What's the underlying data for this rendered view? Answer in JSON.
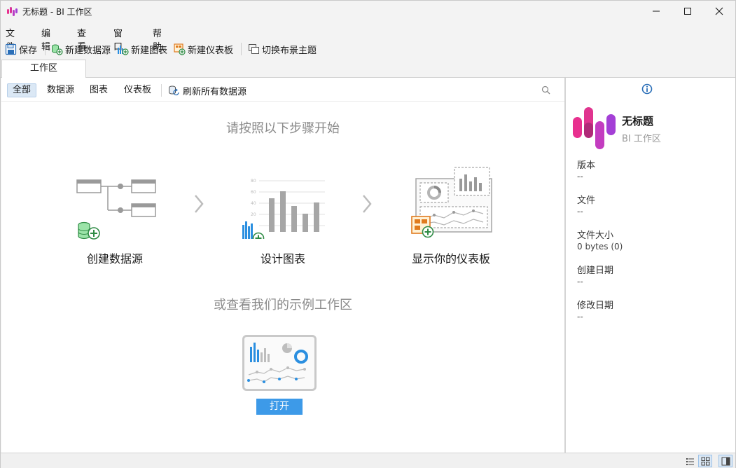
{
  "window": {
    "title": "无标题 - BI 工作区"
  },
  "menu": [
    "文件",
    "编辑",
    "查看",
    "窗口",
    "帮助"
  ],
  "toolbar": {
    "save": "保存",
    "new_datasource": "新建数据源",
    "new_chart": "新建图表",
    "new_dashboard": "新建仪表板",
    "switch_theme": "切换布景主题"
  },
  "tabs": {
    "workspace": "工作区"
  },
  "filters": {
    "all": "全部",
    "datasource": "数据源",
    "chart": "图表",
    "dashboard": "仪表板",
    "refresh": "刷新所有数据源"
  },
  "main": {
    "heading": "请按照以下步骤开始",
    "steps": [
      "创建数据源",
      "设计图表",
      "显示你的仪表板"
    ],
    "sample_heading": "或查看我们的示例工作区",
    "open_label": "打开",
    "chart_axis": [
      "80",
      "60",
      "40",
      "20"
    ]
  },
  "side": {
    "name": "无标题",
    "subtitle": "BI 工作区",
    "props": [
      {
        "label": "版本",
        "value": "--"
      },
      {
        "label": "文件",
        "value": "--"
      },
      {
        "label": "文件大小",
        "value": "0 bytes (0)"
      },
      {
        "label": "创建日期",
        "value": "--"
      },
      {
        "label": "修改日期",
        "value": "--"
      }
    ]
  },
  "colors": {
    "accent": "#3d9ae8",
    "brand_pink": "#e8308f",
    "brand_purple": "#a43fd6",
    "green": "#2ea44f"
  }
}
